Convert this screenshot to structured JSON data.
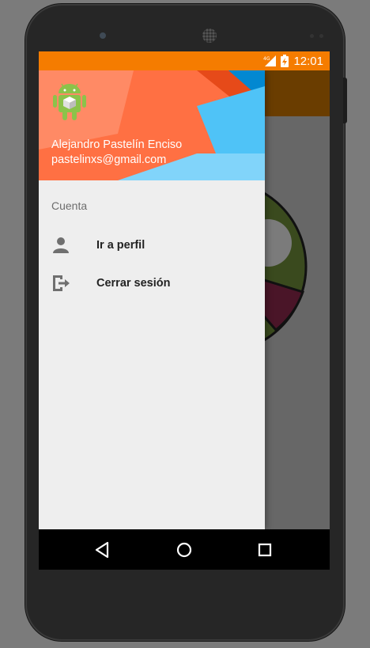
{
  "status_bar": {
    "network": "4G",
    "time": "12:01"
  },
  "drawer": {
    "user_name": "Alejandro Pastelín Enciso",
    "user_email": "pastelinxs@gmail.com",
    "section_label": "Cuenta",
    "items": [
      {
        "label": "Ir a perfil",
        "icon": "person-icon"
      },
      {
        "label": "Cerrar sesión",
        "icon": "exit-icon"
      }
    ]
  },
  "nav_bar": {
    "buttons": [
      "back-icon",
      "home-icon",
      "recents-icon"
    ]
  },
  "colors": {
    "status_bar": "#f57c00",
    "header_orange": "#ff8a65",
    "header_blue": "#29b6f6"
  }
}
